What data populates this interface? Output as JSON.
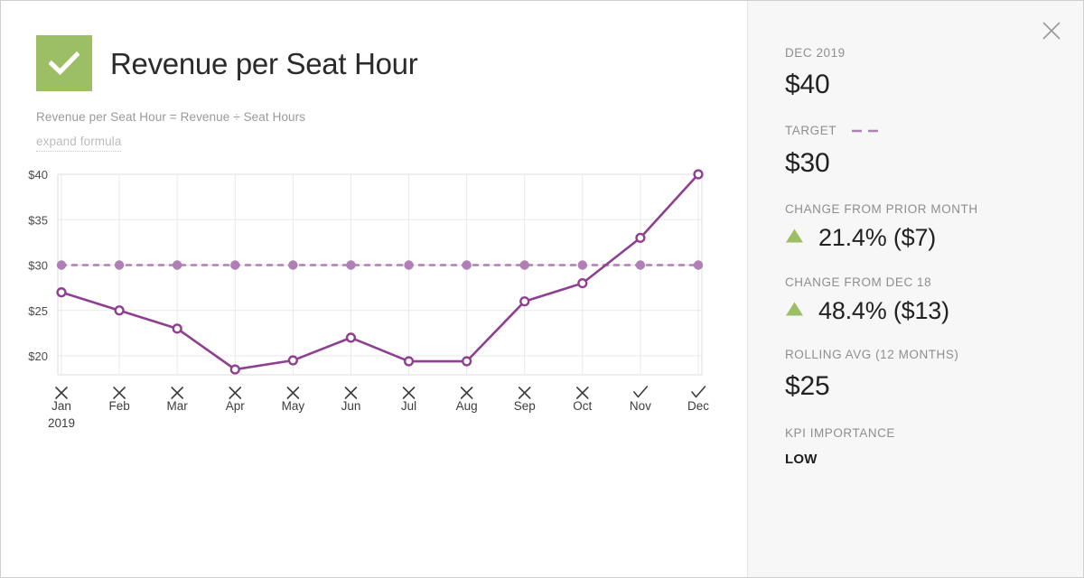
{
  "header": {
    "title": "Revenue per Seat Hour",
    "status_icon": "check-icon",
    "status_color": "#9cbe64",
    "formula": "Revenue per Seat Hour = Revenue ÷ Seat Hours",
    "expand_link": "expand formula"
  },
  "panel": {
    "close_icon": "close-icon",
    "stats": [
      {
        "label": "DEC 2019",
        "value": "$40"
      },
      {
        "label": "TARGET",
        "value": "$30",
        "legend_icon": "dashed-line-swatch",
        "legend_color": "#b07fb5"
      },
      {
        "label": "CHANGE FROM PRIOR MONTH",
        "direction_icon": "triangle-up-icon",
        "direction_color": "#9cbe64",
        "value": "21.4% ($7)"
      },
      {
        "label": "CHANGE FROM DEC 18",
        "direction_icon": "triangle-up-icon",
        "direction_color": "#9cbe64",
        "value": "48.4% ($13)"
      },
      {
        "label": "ROLLING AVG (12 MONTHS)",
        "value": "$25"
      },
      {
        "label": "KPI IMPORTANCE",
        "value": "LOW"
      }
    ]
  },
  "chart_data": {
    "type": "line",
    "title": "Revenue per Seat Hour",
    "xlabel": "",
    "ylabel": "",
    "ylim": [
      17.5,
      40
    ],
    "yticks": [
      20,
      25,
      30,
      35,
      40
    ],
    "ytick_labels": [
      "$20",
      "$25",
      "$30",
      "$35",
      "$40"
    ],
    "grid": true,
    "legend_position": "right-panel",
    "categories": [
      "Jan",
      "Feb",
      "Mar",
      "Apr",
      "May",
      "Jun",
      "Jul",
      "Aug",
      "Sep",
      "Oct",
      "Nov",
      "Dec"
    ],
    "x_sublabel": "2019",
    "x_sublabel_index": 0,
    "status_marks": [
      "x",
      "x",
      "x",
      "x",
      "x",
      "x",
      "x",
      "x",
      "x",
      "x",
      "check",
      "check"
    ],
    "series": [
      {
        "name": "Revenue per Seat Hour",
        "color": "#8e3f91",
        "style": "solid",
        "marker": "open-circle",
        "values": [
          27,
          25,
          23,
          18.5,
          19.5,
          22,
          19.4,
          19.4,
          26,
          28,
          33,
          40
        ]
      },
      {
        "name": "Target",
        "color": "#b07fb5",
        "style": "dashed",
        "marker": "filled-circle",
        "values": [
          30,
          30,
          30,
          30,
          30,
          30,
          30,
          30,
          30,
          30,
          30,
          30
        ]
      }
    ]
  }
}
